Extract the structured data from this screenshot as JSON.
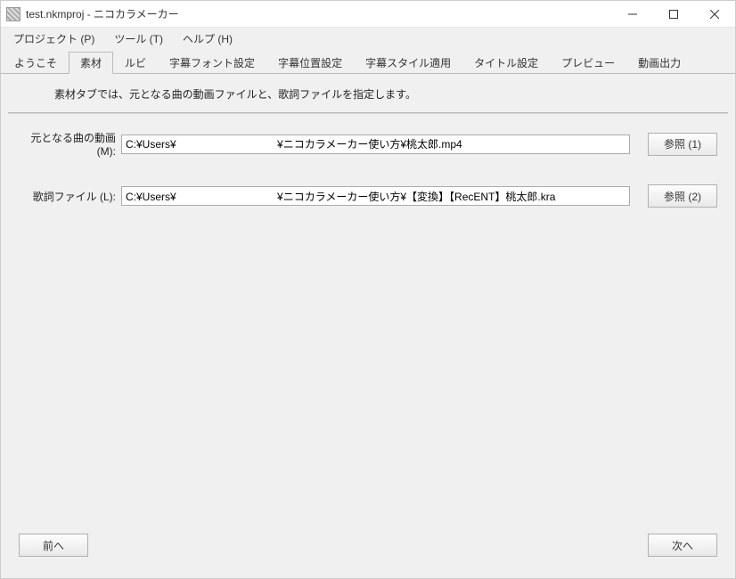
{
  "window": {
    "title": "test.nkmproj - ニコカラメーカー"
  },
  "menu": {
    "project": "プロジェクト (P)",
    "tool": "ツール (T)",
    "help": "ヘルプ (H)"
  },
  "tabs": {
    "welcome": "ようこそ",
    "material": "素材",
    "ruby": "ルビ",
    "font": "字幕フォント設定",
    "position": "字幕位置設定",
    "style": "字幕スタイル適用",
    "title": "タイトル設定",
    "preview": "プレビュー",
    "output": "動画出力"
  },
  "description": "素材タブでは、元となる曲の動画ファイルと、歌詞ファイルを指定します。",
  "fields": {
    "video": {
      "label": "元となる曲の動画 (M):",
      "value": "C:¥Users¥                                  ¥ニコカラメーカー使い方¥桃太郎.mp4",
      "browse": "参照 (1)"
    },
    "lyrics": {
      "label": "歌詞ファイル (L):",
      "value": "C:¥Users¥                                  ¥ニコカラメーカー使い方¥【変換】【RecENT】桃太郎.kra",
      "browse": "参照 (2)"
    }
  },
  "nav": {
    "prev": "前へ",
    "next": "次へ"
  }
}
